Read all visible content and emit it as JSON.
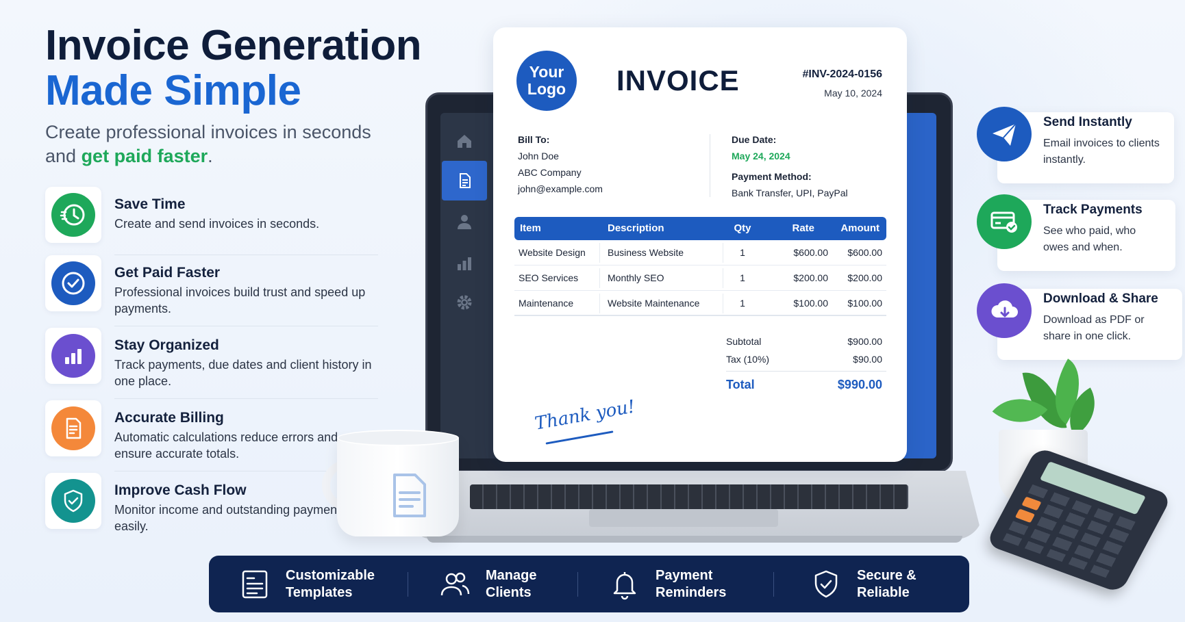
{
  "hero": {
    "title_line1": "Invoice Generation",
    "title_line2": "Made Simple",
    "subtitle_part1": "Create professional invoices in seconds and ",
    "subtitle_highlight": "get paid faster",
    "subtitle_end": "."
  },
  "features": [
    {
      "title": "Save Time",
      "desc": "Create and send invoices in seconds.",
      "color": "#1ea85a",
      "icon": "clock-icon"
    },
    {
      "title": "Get Paid Faster",
      "desc": "Professional invoices build trust and speed up payments.",
      "color": "#1d5bbf",
      "icon": "check-circle-icon"
    },
    {
      "title": "Stay Organized",
      "desc": "Track payments, due dates and client history in one place.",
      "color": "#6b4fcf",
      "icon": "bar-chart-icon"
    },
    {
      "title": "Accurate Billing",
      "desc": "Automatic calculations reduce errors and ensure accurate totals.",
      "color": "#f4883a",
      "icon": "document-icon"
    },
    {
      "title": "Improve Cash Flow",
      "desc": "Monitor income and outstanding payments easily.",
      "color": "#13938f",
      "icon": "shield-check-icon"
    }
  ],
  "invoice": {
    "logo_line1": "Your",
    "logo_line2": "Logo",
    "title": "INVOICE",
    "number": "#INV-2024-0156",
    "date": "May 10, 2024",
    "bill_to_label": "Bill To:",
    "bill_name": "John Doe",
    "bill_company": "ABC Company",
    "bill_email": "john@example.com",
    "due_label": "Due Date:",
    "due_date": "May 24, 2024",
    "payment_label": "Payment Method:",
    "payment_methods": "Bank Transfer, UPI, PayPal",
    "columns": {
      "item": "Item",
      "description": "Description",
      "qty": "Qty",
      "rate": "Rate",
      "amount": "Amount"
    },
    "rows": [
      {
        "item": "Website Design",
        "description": "Business Website",
        "qty": "1",
        "rate": "$600.00",
        "amount": "$600.00"
      },
      {
        "item": "SEO Services",
        "description": "Monthly SEO",
        "qty": "1",
        "rate": "$200.00",
        "amount": "$200.00"
      },
      {
        "item": "Maintenance",
        "description": "Website Maintenance",
        "qty": "1",
        "rate": "$100.00",
        "amount": "$100.00"
      }
    ],
    "subtotal_label": "Subtotal",
    "subtotal": "$900.00",
    "tax_label": "Tax (10%)",
    "tax": "$90.00",
    "total_label": "Total",
    "total": "$990.00",
    "thanks": "Thank you!",
    "accent": "#1d5bbf"
  },
  "right_cards": [
    {
      "title": "Send Instantly",
      "desc": "Email invoices to clients instantly.",
      "color": "#1d5bbf",
      "icon": "paper-plane-icon"
    },
    {
      "title": "Track Payments",
      "desc": "See who paid, who owes and when.",
      "color": "#1ea85a",
      "icon": "credit-card-check-icon"
    },
    {
      "title": "Download & Share",
      "desc": "Download as PDF or share in one click.",
      "color": "#6b4fcf",
      "icon": "cloud-download-icon"
    }
  ],
  "bottom_bar": [
    {
      "line1": "Customizable",
      "line2": "Templates",
      "icon": "template-icon"
    },
    {
      "line1": "Manage",
      "line2": "Clients",
      "icon": "users-icon"
    },
    {
      "line1": "Payment",
      "line2": "Reminders",
      "icon": "bell-icon"
    },
    {
      "line1": "Secure &",
      "line2": "Reliable",
      "icon": "shield-check-icon"
    }
  ],
  "sidebar_icons": [
    "home-icon",
    "document-icon",
    "user-icon",
    "chart-icon",
    "gear-icon"
  ]
}
